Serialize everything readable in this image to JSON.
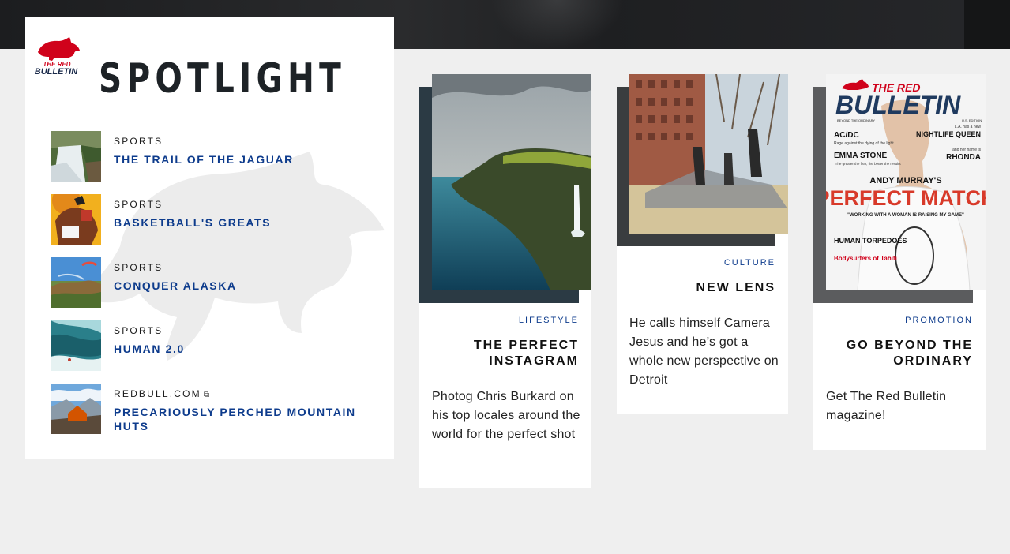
{
  "spotlight": {
    "title": "SPOTLIGHT",
    "logo": {
      "name": "The Red Bulletin",
      "text_line1": "THE RED",
      "text_line2": "BULLETIN"
    },
    "items": [
      {
        "category": "SPORTS",
        "title": "THE TRAIL OF THE JAGUAR",
        "thumb": "waterfall"
      },
      {
        "category": "SPORTS",
        "title": "BASKETBALL'S GREATS",
        "thumb": "basketball"
      },
      {
        "category": "SPORTS",
        "title": "CONQUER ALASKA",
        "thumb": "paraglider"
      },
      {
        "category": "SPORTS",
        "title": "HUMAN 2.0",
        "thumb": "surf"
      },
      {
        "category": "REDBULL.COM",
        "external_icon": "external-link-icon",
        "title": "PRECARIOUSLY PERCHED MOUNTAIN HUTS",
        "thumb": "mountain-hut"
      }
    ]
  },
  "cards": [
    {
      "tag": "LIFESTYLE",
      "title": "THE PERFECT INSTAGRAM",
      "description": "Photog Chris Burkard on his top locales around the world for the perfect shot"
    },
    {
      "tag": "CULTURE",
      "title": "NEW LENS",
      "description": "He calls himself Camera Jesus and he’s got a whole new perspective on Detroit"
    },
    {
      "tag": "PROMOTION",
      "title": "GO BEYOND THE ORDINARY",
      "description": "Get The Red Bulletin magazine!",
      "magazine": {
        "masthead_top": "THE RED",
        "masthead": "BULLETIN",
        "tagline": "BEYOND THE ORDINARY",
        "edition": "U.S. EDITION",
        "left1_title": "AC/DC",
        "left1_sub": "Rage against the dying of the light",
        "left2_title": "EMMA STONE",
        "left2_sub": "\"The greater the fear, the better the results\"",
        "right_top": "L.A. has a new",
        "right_title": "NIGHTLIFE QUEEN",
        "right_sub": "and her name is",
        "right_name": "RHONDA",
        "headline_small": "ANDY MURRAY'S",
        "headline_big": "PERFECT MATCH",
        "quote": "\"WORKING WITH A WOMAN IS RAISING MY GAME\"",
        "bottom_title": "HUMAN TORPEDOES",
        "bottom_sub": "Bodysurfers of Tahiti"
      }
    }
  ],
  "colors": {
    "link_blue": "#0d3b8c",
    "brand_red": "#d0021b",
    "page_bg": "#efefef"
  }
}
